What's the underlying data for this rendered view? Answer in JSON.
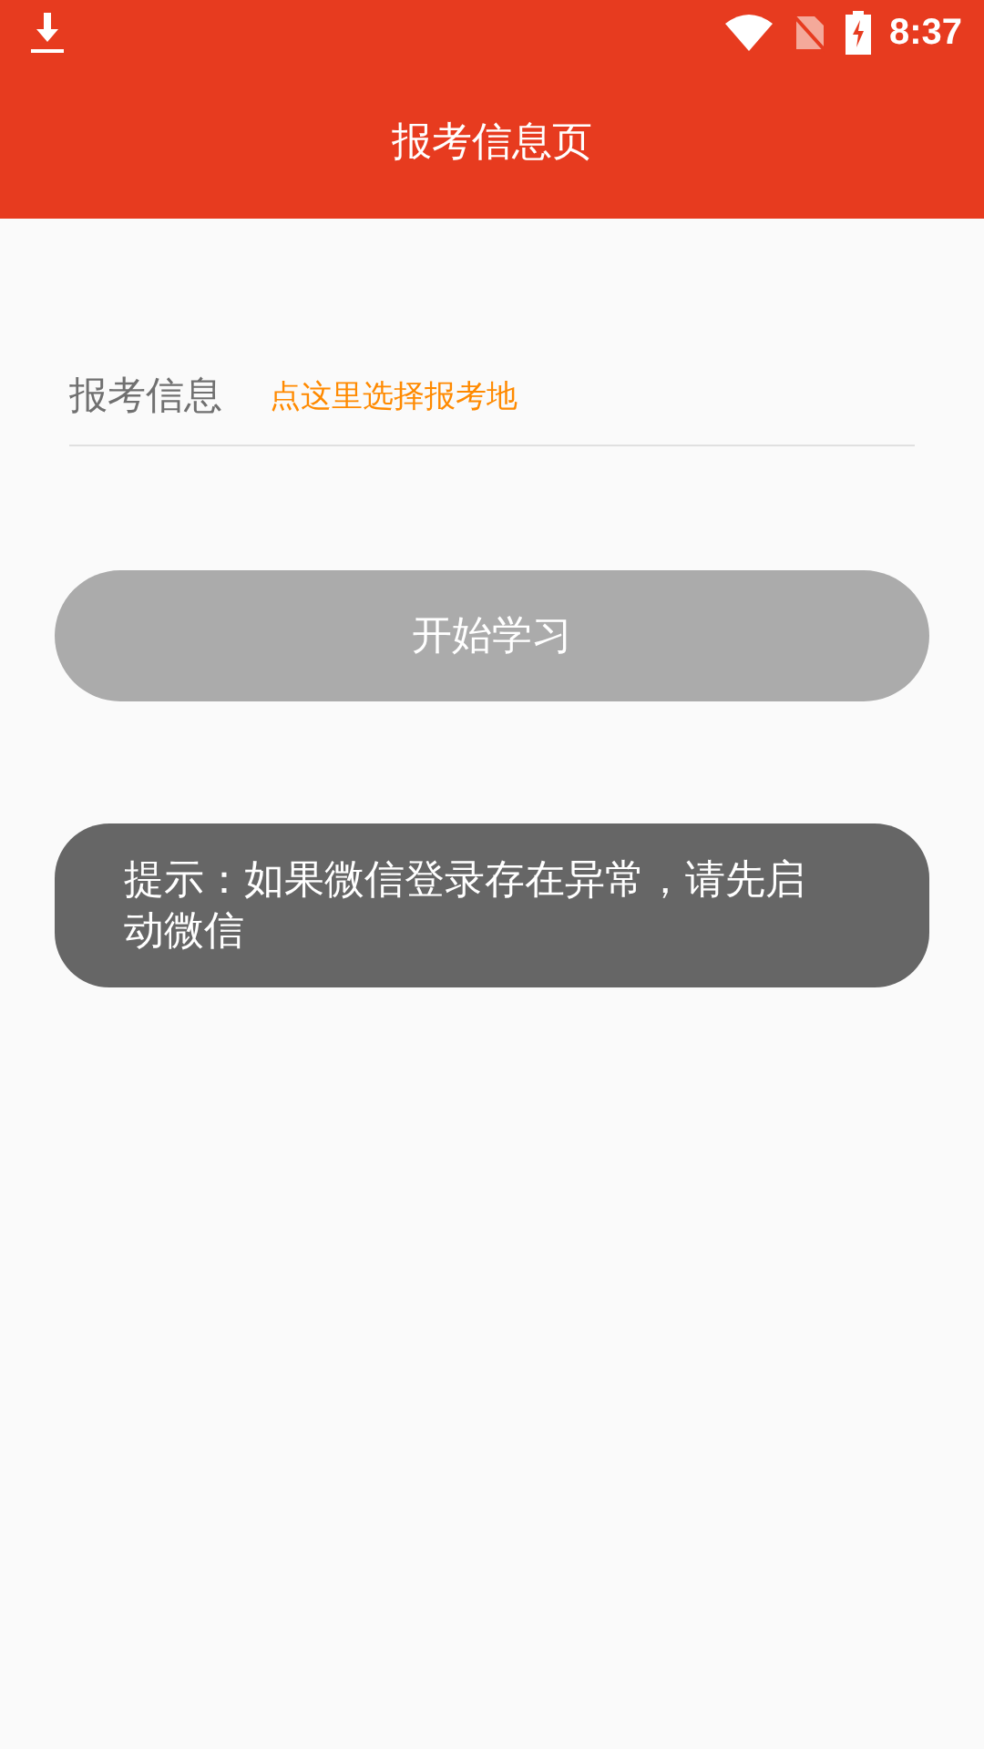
{
  "status_bar": {
    "time": "8:37"
  },
  "app_bar": {
    "title": "报考信息页"
  },
  "exam_info": {
    "label": "报考信息",
    "value": "点这里选择报考地"
  },
  "start_button": {
    "label": "开始学习",
    "disabled": true
  },
  "notice": {
    "text": "提示：如果微信登录存在异常，请先启动微信"
  }
}
